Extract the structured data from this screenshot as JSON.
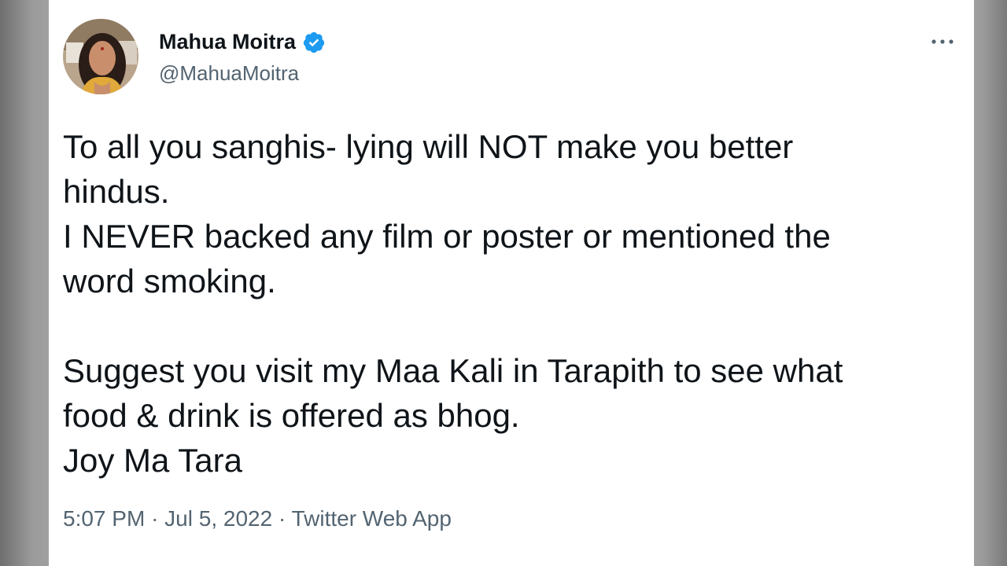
{
  "tweet": {
    "author": {
      "display_name": "Mahua Moitra",
      "handle": "@MahuaMoitra",
      "verified": true,
      "avatar_icon": "profile-photo"
    },
    "menu_icon": "more-options-icon",
    "text_lines": [
      "To all you sanghis- lying will NOT make you better",
      "hindus.",
      "I NEVER backed any film or poster or mentioned the",
      "word smoking.",
      "",
      "Suggest you visit my Maa Kali in Tarapith to see what",
      "food & drink is offered as bhog.",
      "Joy Ma Tara"
    ],
    "meta": {
      "time": "5:07 PM",
      "separator": "·",
      "date": "Jul 5, 2022",
      "source": "Twitter Web App"
    }
  },
  "colors": {
    "text": "#0f1419",
    "secondary_text": "#536471",
    "verified_badge": "#1d9bf0",
    "card_background": "#ffffff"
  }
}
